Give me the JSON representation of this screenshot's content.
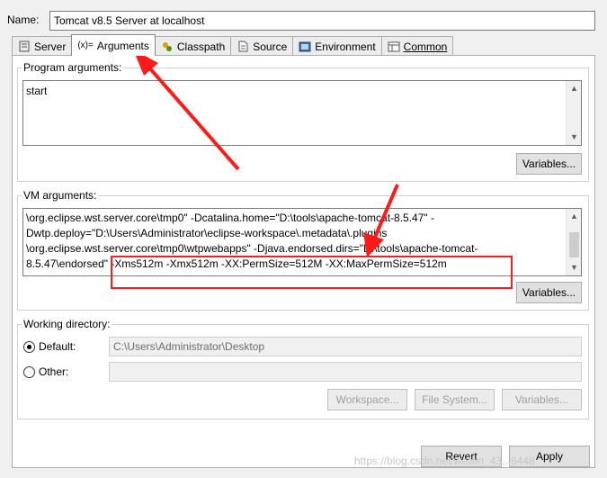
{
  "name": {
    "label": "Name:",
    "value": "Tomcat v8.5 Server at localhost"
  },
  "tabs": [
    {
      "label": "Server",
      "icon": "server-icon"
    },
    {
      "label": "Arguments",
      "icon": "arguments-icon",
      "prefix": "(x)="
    },
    {
      "label": "Classpath",
      "icon": "classpath-icon"
    },
    {
      "label": "Source",
      "icon": "source-icon"
    },
    {
      "label": "Environment",
      "icon": "environment-icon"
    },
    {
      "label": "Common",
      "icon": "common-icon"
    }
  ],
  "program_args": {
    "label": "Program arguments:",
    "value": "start",
    "variables_label": "Variables..."
  },
  "vm_args": {
    "label": "VM arguments:",
    "lines": [
      "\\org.eclipse.wst.server.core\\tmp0\" -Dcatalina.home=\"D:\\tools\\apache-tomcat-8.5.47\" -",
      "Dwtp.deploy=\"D:\\Users\\Administrator\\eclipse-workspace\\.metadata\\.plugins",
      "\\org.eclipse.wst.server.core\\tmp0\\wtpwebapps\" -Djava.endorsed.dirs=\"D:\\tools\\apache-tomcat-",
      "8.5.47\\endorsed\" -Xms512m -Xmx512m -XX:PermSize=512M -XX:MaxPermSize=512m"
    ],
    "variables_label": "Variables..."
  },
  "working_dir": {
    "label": "Working directory:",
    "default_label": "Default:",
    "default_value": "C:\\Users\\Administrator\\Desktop",
    "other_label": "Other:",
    "other_value": "",
    "selected": "Default",
    "workspace_label": "Workspace...",
    "filesystem_label": "File System...",
    "variables_label": "Variables..."
  },
  "footer": {
    "revert_label": "Revert",
    "apply_label": "Apply"
  },
  "watermark": "https://blog.csdn.net/weixin_43...6448",
  "colors": {
    "annotation": "#ff1a1a",
    "accent_text": "#000000"
  }
}
